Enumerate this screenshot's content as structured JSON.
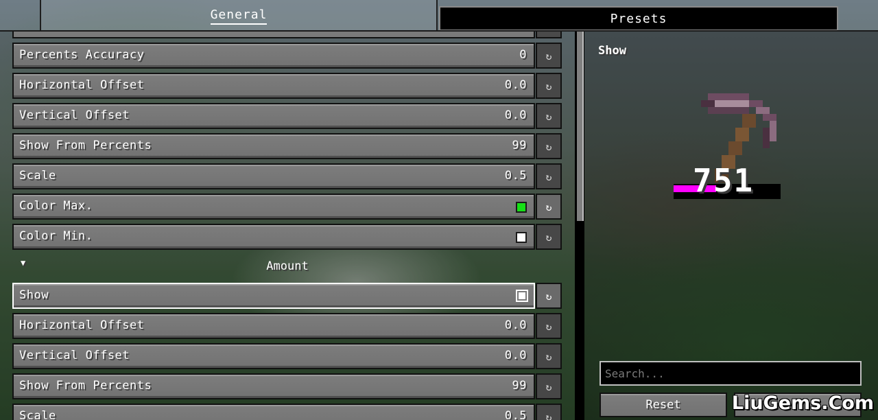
{
  "tabs": [
    {
      "label": "General",
      "active": true
    },
    {
      "label": "Presets",
      "active": false
    }
  ],
  "list": {
    "rows": [
      {
        "label": "Percents Accuracy",
        "value": "0",
        "kind": "number"
      },
      {
        "label": "Horizontal Offset",
        "value": "0.0",
        "kind": "number"
      },
      {
        "label": "Vertical Offset",
        "value": "0.0",
        "kind": "number"
      },
      {
        "label": "Show From Percents",
        "value": "99",
        "kind": "number"
      },
      {
        "label": "Scale",
        "value": "0.5",
        "kind": "number"
      },
      {
        "label": "Color Max.",
        "kind": "color",
        "color": "#16e016"
      },
      {
        "label": "Color Min.",
        "kind": "color",
        "color": "#ffffff"
      }
    ],
    "section": {
      "title": "Amount",
      "collapse_icon": "triangle-down-icon"
    },
    "section_rows": [
      {
        "label": "Show",
        "kind": "checkbox",
        "checked": true
      },
      {
        "label": "Horizontal Offset",
        "value": "0.0",
        "kind": "number"
      },
      {
        "label": "Vertical Offset",
        "value": "0.0",
        "kind": "number"
      },
      {
        "label": "Show From Percents",
        "value": "99",
        "kind": "number"
      },
      {
        "label": "Scale",
        "value": "0.5",
        "kind": "number"
      }
    ],
    "reset_icon": "reset-icon"
  },
  "preview": {
    "title": "Show",
    "durability_value": "751",
    "durability_fraction": 0.4,
    "bar_color": "#ff00ff",
    "item_icon": "pickaxe-icon"
  },
  "search": {
    "placeholder": "Search..."
  },
  "buttons": {
    "reset": "Reset",
    "done": ""
  },
  "watermark": "LiuGems.Com"
}
